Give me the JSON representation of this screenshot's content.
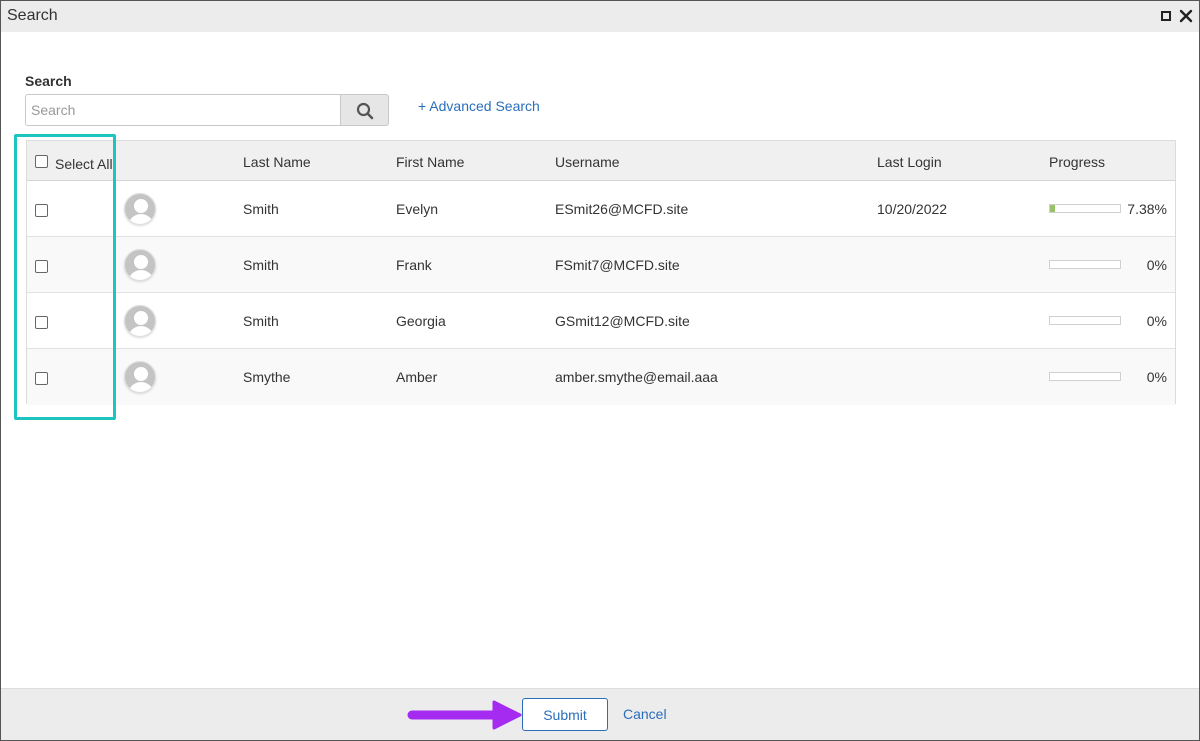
{
  "window": {
    "title": "Search"
  },
  "search": {
    "label": "Search",
    "placeholder": "Search",
    "value": "",
    "advanced_link": "+ Advanced Search"
  },
  "table": {
    "headers": {
      "select_all": "Select All",
      "last_name": "Last Name",
      "first_name": "First Name",
      "username": "Username",
      "last_login": "Last Login",
      "progress": "Progress"
    },
    "rows": [
      {
        "last_name": "Smith",
        "first_name": "Evelyn",
        "username": "ESmit26@MCFD.site",
        "last_login": "10/20/2022",
        "progress_label": "7.38%",
        "progress_value": 7.38
      },
      {
        "last_name": "Smith",
        "first_name": "Frank",
        "username": "FSmit7@MCFD.site",
        "last_login": "",
        "progress_label": "0%",
        "progress_value": 0
      },
      {
        "last_name": "Smith",
        "first_name": "Georgia",
        "username": "GSmit12@MCFD.site",
        "last_login": "",
        "progress_label": "0%",
        "progress_value": 0
      },
      {
        "last_name": "Smythe",
        "first_name": "Amber",
        "username": "amber.smythe@email.aaa",
        "last_login": "",
        "progress_label": "0%",
        "progress_value": 0
      }
    ]
  },
  "footer": {
    "submit_label": "Submit",
    "cancel_label": "Cancel"
  },
  "icons": {
    "search": "search-icon",
    "maximize": "maximize-icon",
    "close": "close-icon",
    "avatar": "user-avatar-icon"
  },
  "colors": {
    "accent": "#2a6ebb",
    "highlight": "#1ec5c0",
    "arrow": "#a52bf0",
    "progress_fill": "#9bc06a"
  }
}
